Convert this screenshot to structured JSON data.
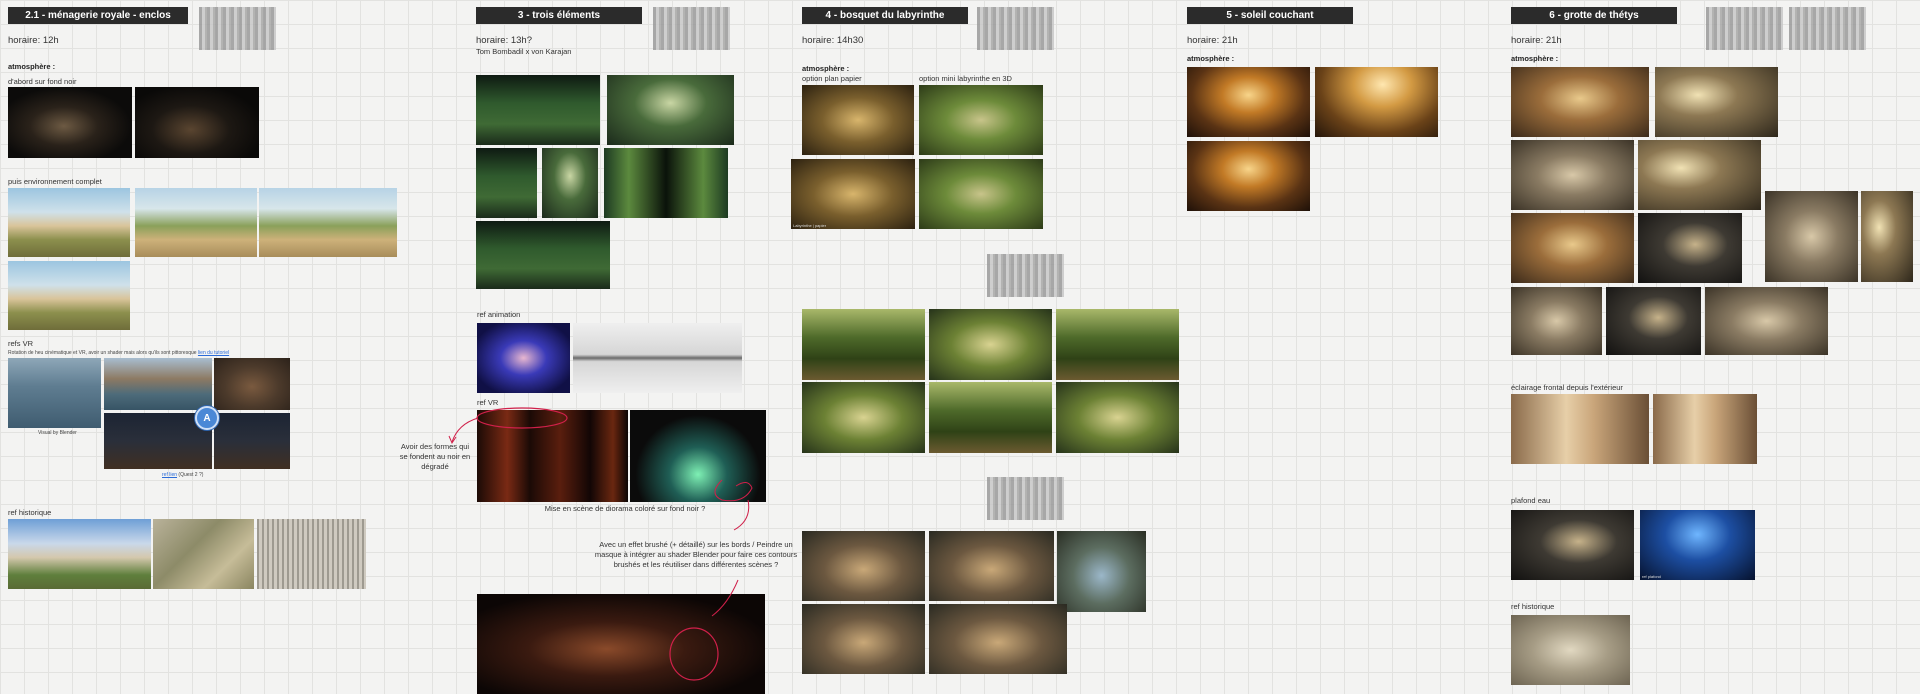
{
  "sections": {
    "s21": {
      "title": "2.1 - ménagerie royale - enclos",
      "horaire": "horaire: 12h",
      "atmosphere": "atmosphère :",
      "label_fond_noir": "d'abord sur fond noir",
      "label_env": "puis environnement complet",
      "label_refs_vr": "refs VR",
      "vr_note": "Rotation de heu cinématique et VR, avoir un shader mais alors qu'ils sont pittoresque",
      "vr_link": "lien du tutoriel",
      "vr_cap1": "Visual by Blender",
      "vr_link2": "ref lien",
      "vr_link2_suffix": "(Quest 2 ?)",
      "label_ref_historique": "ref historique"
    },
    "s3": {
      "title": "3 - trois éléments",
      "horaire": "horaire: 13h?",
      "subtitle": "Tom Bombadil x von Karajan",
      "label_ref_animation": "ref animation",
      "label_ref_vr": "ref VR",
      "note_left": "Avoir des formes qui se fondent au noir en dégradé",
      "note_diorama": "Mise en scène de diorama coloré sur fond noir ?",
      "note_brush": "Avec un effet brushé (+ détaillé) sur les bords / Peindre un masque à intégrer au shader Blender pour faire ces contours brushés et les réutiliser dans différentes scènes ?"
    },
    "s4": {
      "title": "4 - bosquet du labyrinthe",
      "horaire": "horaire: 14h30",
      "atmosphere": "atmosphère :",
      "option_papier": "option plan papier",
      "option_3d": "option mini labyrinthe en 3D",
      "cap_papier": "Labyrinthe | papier"
    },
    "s5": {
      "title": "5 - soleil couchant",
      "horaire": "horaire: 21h",
      "atmosphere": "atmosphère :"
    },
    "s6": {
      "title": "6 - grotte de thétys",
      "horaire": "horaire: 21h",
      "atmosphere": "atmosphère :",
      "label_eclairage": "éclairage frontal depuis l'extérieur",
      "label_plafond": "plafond eau",
      "label_ref_historique": "ref historique",
      "cap_blue": "ref plafond"
    }
  },
  "cursor": {
    "label": "A",
    "color": "#4a88d6"
  },
  "colors": {
    "badge_bg": "#2b2b2b",
    "board_bg": "#f3f3f2",
    "annotation_red": "#d0204a",
    "link": "#2a6bd8"
  }
}
